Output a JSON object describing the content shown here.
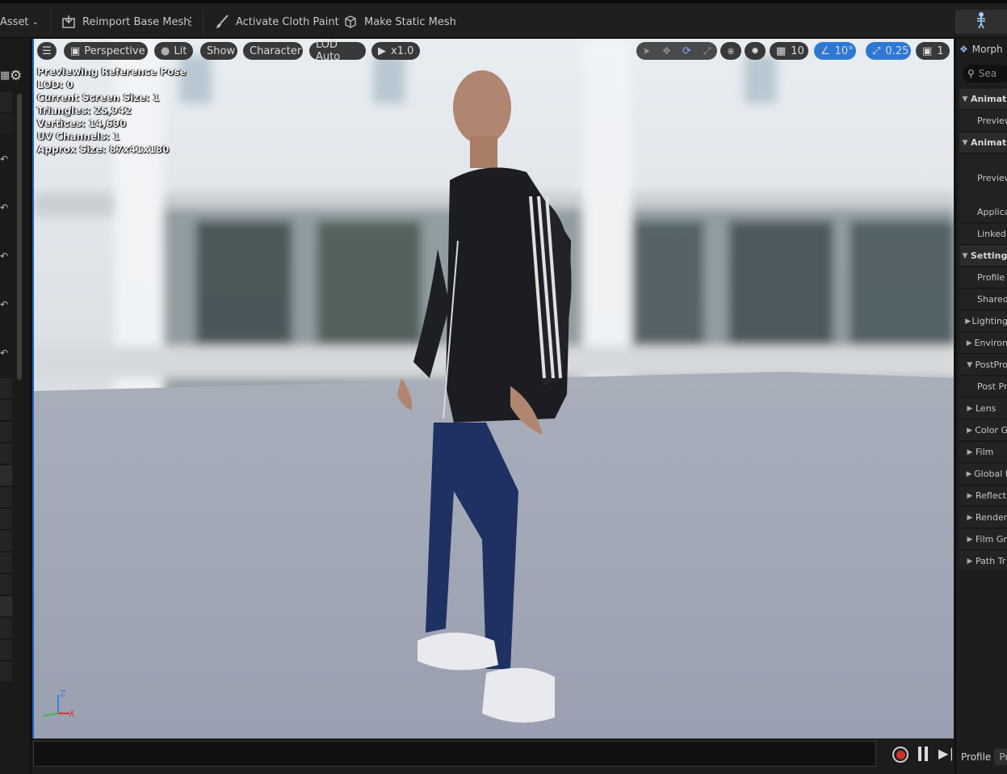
{
  "toolbar": {
    "asset_menu": "Asset",
    "reimport_label": "Reimport Base Mesh",
    "cloth_paint_label": "Activate Cloth Paint",
    "static_mesh_label": "Make Static Mesh"
  },
  "viewport": {
    "menu_icon": "hamburger-icon",
    "perspective": "Perspective",
    "lit": "Lit",
    "show": "Show",
    "character": "Character",
    "lod": "LOD Auto",
    "play_rate": "x1.0",
    "grid_size": "10",
    "angle_snap": "10°",
    "scale_snap": "0.25",
    "camera_speed": "1",
    "info": {
      "line1": "Previewing Reference Pose",
      "line2": "LOD: 0",
      "line3": "Current Screen Size: 1",
      "line4": "Triangles: 25,942",
      "line5": "Vertices: 14,690",
      "line6": "UV Channels: 1",
      "line7": "Approx Size: 87x41x180"
    },
    "axis": {
      "z": "Z",
      "x": "X"
    }
  },
  "right_panel": {
    "tab": "Morph",
    "search_placeholder": "Sea",
    "rows": [
      {
        "label": "Animat",
        "kind": "cat"
      },
      {
        "label": "Preview",
        "kind": "sub"
      },
      {
        "label": "Animat",
        "kind": "cat"
      },
      {
        "label": "Preview",
        "kind": "sub"
      },
      {
        "label": "Applica",
        "kind": "sub"
      },
      {
        "label": "Linked A",
        "kind": "sub"
      },
      {
        "label": "Setting",
        "kind": "cat"
      },
      {
        "label": "Profile N",
        "kind": "sub"
      },
      {
        "label": "Shared",
        "kind": "sub"
      },
      {
        "label": "Lighting",
        "kind": "exp"
      },
      {
        "label": "Environ",
        "kind": "exp"
      },
      {
        "label": "PostPro",
        "kind": "cat2"
      },
      {
        "label": "Post Pr",
        "kind": "sub"
      },
      {
        "label": "Lens",
        "kind": "exp"
      },
      {
        "label": "Color G",
        "kind": "exp"
      },
      {
        "label": "Film",
        "kind": "exp"
      },
      {
        "label": "Global I",
        "kind": "exp"
      },
      {
        "label": "Reflect",
        "kind": "exp"
      },
      {
        "label": "Render",
        "kind": "exp"
      },
      {
        "label": "Film Gr",
        "kind": "exp"
      },
      {
        "label": "Path Tr",
        "kind": "exp"
      }
    ],
    "profile_label": "Profile",
    "profile_value": "Pr"
  },
  "colors": {
    "accent": "#1f6fd1",
    "record": "#d03030"
  }
}
